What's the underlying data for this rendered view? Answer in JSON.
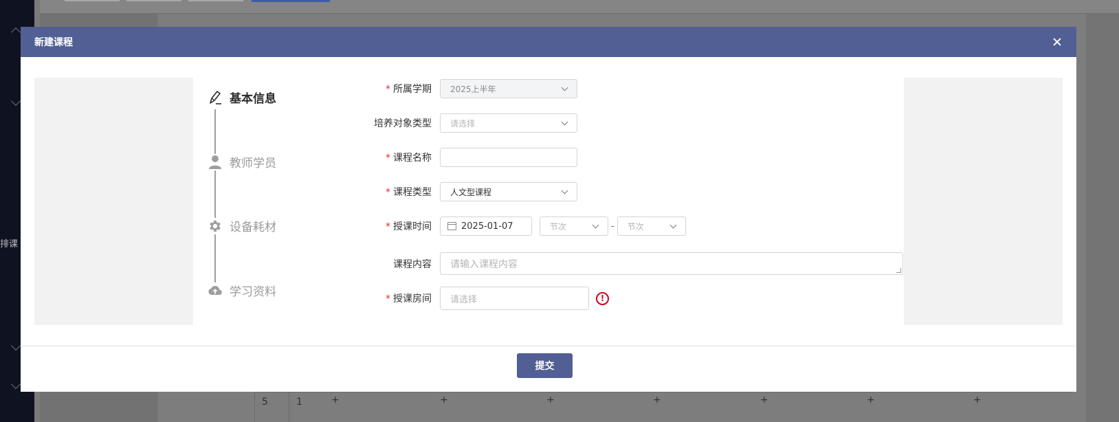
{
  "background": {
    "sidebar_label": "排课",
    "grid_plus": [
      "+",
      "+",
      "+",
      "+",
      "+",
      "+",
      "+"
    ],
    "grid_row_values": [
      "5",
      "1"
    ]
  },
  "modal": {
    "title": "新建课程",
    "close_icon": "close-icon",
    "steps": [
      {
        "label": "基本信息",
        "icon": "pencil-icon",
        "active": true
      },
      {
        "label": "教师学员",
        "icon": "user-icon",
        "active": false
      },
      {
        "label": "设备耗材",
        "icon": "gear-icon",
        "active": false
      },
      {
        "label": "学习资料",
        "icon": "cloud-upload-icon",
        "active": false
      }
    ],
    "form": {
      "semester": {
        "label": "所属学期",
        "required": "*",
        "value": "2025上半年"
      },
      "target_type": {
        "label": "培养对象类型",
        "placeholder": "请选择"
      },
      "course_name": {
        "label": "课程名称",
        "required": "*",
        "value": ""
      },
      "course_type": {
        "label": "课程类型",
        "required": "*",
        "value": "人文型课程"
      },
      "teach_time": {
        "label": "授课时间",
        "required": "*",
        "date": "2025-01-07",
        "period_start_placeholder": "节次",
        "period_end_placeholder": "节次",
        "separator": "-"
      },
      "course_content": {
        "label": "课程内容",
        "placeholder": "请输入课程内容"
      },
      "room": {
        "label": "授课房间",
        "required": "*",
        "placeholder": "请选择",
        "error_mark": "!"
      }
    },
    "submit_label": "提交"
  },
  "colors": {
    "header": "#515f94",
    "required": "#e0302a",
    "error": "#d0021b"
  }
}
